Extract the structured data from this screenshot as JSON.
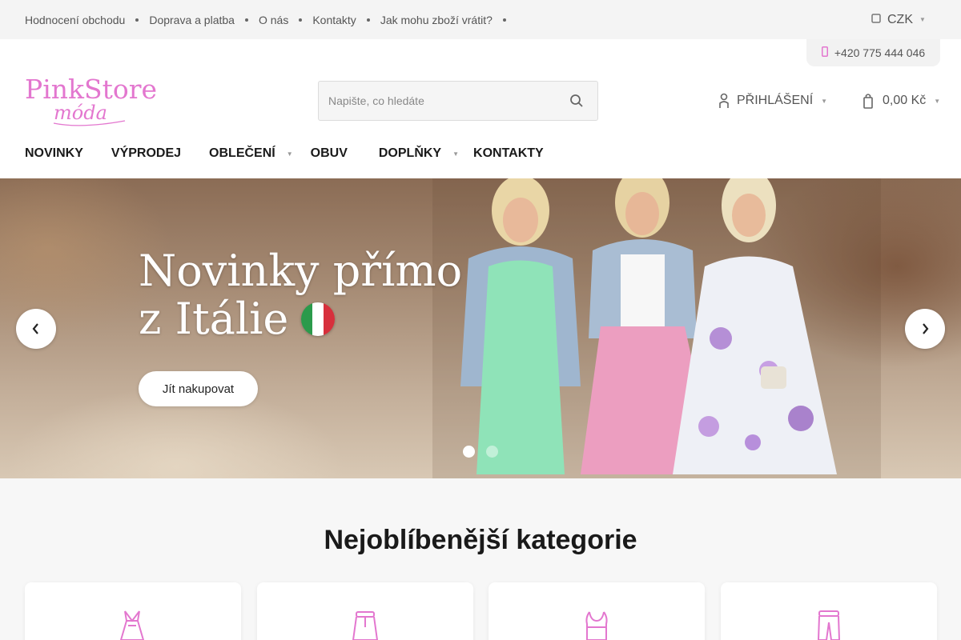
{
  "topbar": {
    "links": [
      {
        "label": "Hodnocení obchodu"
      },
      {
        "label": "Doprava a platba"
      },
      {
        "label": "O nás"
      },
      {
        "label": "Kontakty"
      },
      {
        "label": "Jak mohu zboží vrátit?"
      }
    ],
    "currency": "CZK"
  },
  "header": {
    "phone": "+420 775 444 046",
    "logo_text": "PinkStore",
    "logo_sub": "móda",
    "search_placeholder": "Napište, co hledáte",
    "login_label": "Přihlášení",
    "cart_total": "0,00 Kč"
  },
  "nav": {
    "items": [
      {
        "label": "NOVINKY",
        "has_submenu": false
      },
      {
        "label": "VÝPRODEJ",
        "has_submenu": false
      },
      {
        "label": "OBLEČENÍ",
        "has_submenu": true
      },
      {
        "label": "OBUV",
        "has_submenu": false
      },
      {
        "label": "DOPLŇKY",
        "has_submenu": true
      },
      {
        "label": "KONTAKTY",
        "has_submenu": false
      }
    ]
  },
  "hero": {
    "title_line1": "Novinky přímo",
    "title_line2": "z Itálie",
    "cta_label": "Jít nakupovat",
    "active_slide": 1,
    "slide_count": 2
  },
  "categories": {
    "title": "Nejoblíbenější kategorie",
    "icons": [
      "dress-icon",
      "skirt-icon",
      "top-icon",
      "pants-icon"
    ]
  },
  "colors": {
    "brand_pink": "#e377cf",
    "text_dark": "#1a1a1a",
    "topbar_bg": "#f4f4f4",
    "page_bg": "#f7f7f7"
  }
}
